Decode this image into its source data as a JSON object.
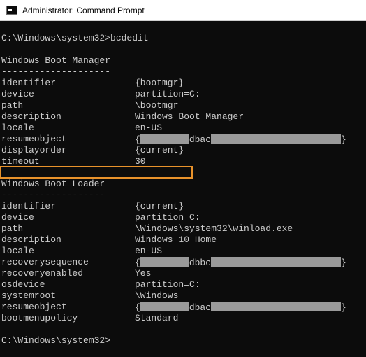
{
  "window": {
    "title": "Administrator: Command Prompt",
    "app_icon": "cmd-icon"
  },
  "console": {
    "command_line": "C:\\Windows\\system32>bcdedit",
    "boot_manager": {
      "header": "Windows Boot Manager",
      "underline": "--------------------",
      "entries": [
        {
          "key": "identifier",
          "value": "{bootmgr}"
        },
        {
          "key": "device",
          "value": "partition=C:"
        },
        {
          "key": "path",
          "value": "\\bootmgr"
        },
        {
          "key": "description",
          "value": "Windows Boot Manager"
        },
        {
          "key": "locale",
          "value": "en-US"
        },
        {
          "key": "resumeobject",
          "prefix": "{",
          "mid": "dbac",
          "suffix": "}"
        },
        {
          "key": "displayorder",
          "value": "{current}"
        },
        {
          "key": "timeout",
          "value": "30"
        }
      ]
    },
    "boot_loader": {
      "header": "Windows Boot Loader",
      "underline": "-------------------",
      "entries": [
        {
          "key": "identifier",
          "value": "{current}"
        },
        {
          "key": "device",
          "value": "partition=C:"
        },
        {
          "key": "path",
          "value": "\\Windows\\system32\\winload.exe"
        },
        {
          "key": "description",
          "value": "Windows 10 Home"
        },
        {
          "key": "locale",
          "value": "en-US"
        },
        {
          "key": "recoverysequence",
          "prefix": "{",
          "mid": "dbbc",
          "suffix": "}"
        },
        {
          "key": "recoveryenabled",
          "value": "Yes"
        },
        {
          "key": "osdevice",
          "value": "partition=C:"
        },
        {
          "key": "systemroot",
          "value": "\\Windows"
        },
        {
          "key": "resumeobject",
          "prefix": "{",
          "mid": "dbac",
          "suffix": "}"
        },
        {
          "key": "bootmenupolicy",
          "value": "Standard"
        }
      ]
    },
    "prompt": "C:\\Windows\\system32>"
  },
  "colors": {
    "console_bg": "#0c0c0c",
    "console_text": "#cccccc",
    "highlight_border": "#e8922b",
    "redaction": "#9a9a9a"
  }
}
